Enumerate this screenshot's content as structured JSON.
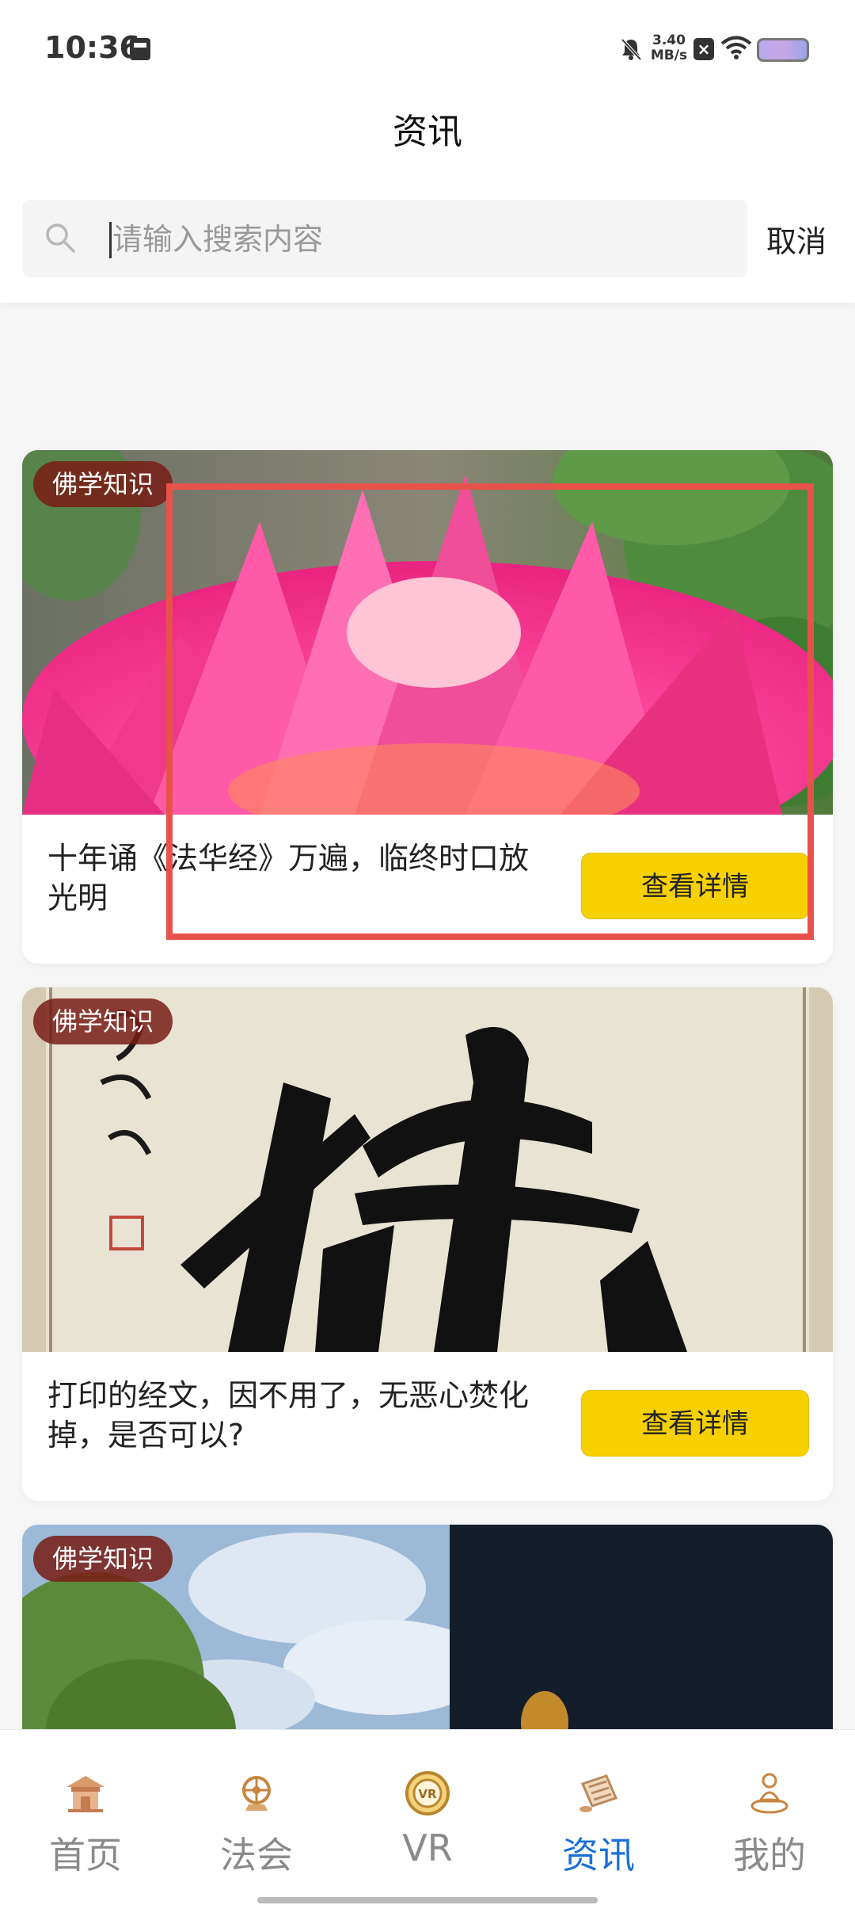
{
  "status_bar": {
    "time": "10:36",
    "network_speed": "3.40\nMB/s",
    "network_speed_value": "3.40",
    "network_speed_unit": "MB/s"
  },
  "header": {
    "title": "资讯",
    "search_placeholder": "请输入搜索内容",
    "cancel_label": "取消"
  },
  "cards": [
    {
      "tag": "佛学知识",
      "title": "十年诵《法华经》万遍，临终时口放光明",
      "button": "查看详情"
    },
    {
      "tag": "佛学知识",
      "title": "打印的经文，因不用了，无恶心焚化掉，是否可以?",
      "button": "查看详情"
    },
    {
      "tag": "佛学知识"
    }
  ],
  "bottom_nav": {
    "items": [
      {
        "label": "首页",
        "icon": "temple-icon",
        "active": false
      },
      {
        "label": "法会",
        "icon": "dharma-wheel-icon",
        "active": false
      },
      {
        "label": "VR",
        "icon": "vr-icon",
        "active": false
      },
      {
        "label": "资讯",
        "icon": "scroll-icon",
        "active": true
      },
      {
        "label": "我的",
        "icon": "meditation-icon",
        "active": false
      }
    ]
  },
  "colors": {
    "accent": "#1a6fd8",
    "button_yellow": "#f7d000",
    "tag_bg": "#7a1c14",
    "highlight": "#e8524a"
  }
}
